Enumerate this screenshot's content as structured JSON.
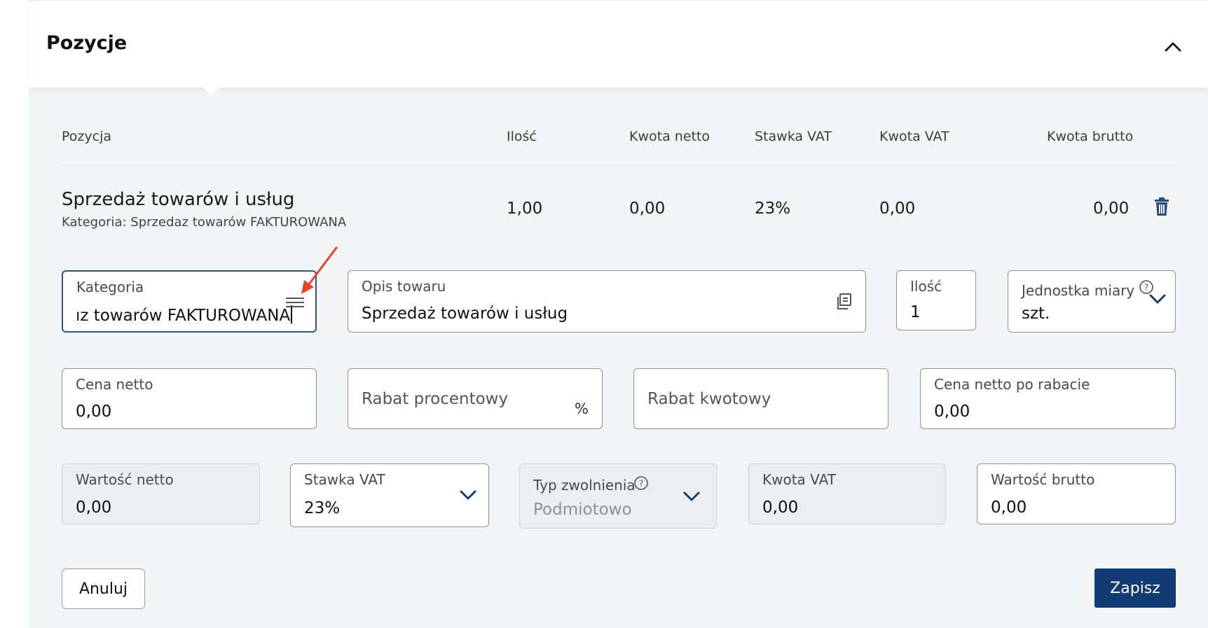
{
  "section": {
    "title": "Pozycje"
  },
  "table": {
    "headers": [
      "Pozycja",
      "Ilość",
      "Kwota netto",
      "Stawka VAT",
      "Kwota VAT",
      "Kwota brutto"
    ],
    "row": {
      "name": "Sprzedaż towarów i usług",
      "category": "Kategoria: Sprzedaz towarów FAKTUROWANA",
      "qty": "1,00",
      "net": "0,00",
      "vat_rate": "23%",
      "vat_amount": "0,00",
      "gross": "0,00"
    }
  },
  "form": {
    "kategoria": {
      "label": "Kategoria",
      "value": "ız towarów FAKTUROWANA"
    },
    "opis": {
      "label": "Opis towaru",
      "value": "Sprzedaż towarów i usług"
    },
    "ilosc": {
      "label": "Ilość",
      "value": "1"
    },
    "jednostka": {
      "label": "Jednostka miary",
      "value": "szt."
    },
    "cena_netto": {
      "label": "Cena netto",
      "value": "0,00"
    },
    "rabat_proc": {
      "placeholder": "Rabat procentowy",
      "suffix": "%"
    },
    "rabat_kwot": {
      "placeholder": "Rabat kwotowy"
    },
    "cena_po_rabacie": {
      "label": "Cena netto po rabacie",
      "value": "0,00"
    },
    "wartosc_netto": {
      "label": "Wartość netto",
      "value": "0,00"
    },
    "stawka_vat": {
      "label": "Stawka VAT",
      "value": "23%"
    },
    "typ_zwolnienia": {
      "label": "Typ zwolnienia",
      "value": "Podmiotowo"
    },
    "kwota_vat": {
      "label": "Kwota VAT",
      "value": "0,00"
    },
    "wartosc_brutto": {
      "label": "Wartość brutto",
      "value": "0,00"
    }
  },
  "buttons": {
    "cancel": "Anuluj",
    "save": "Zapisz"
  },
  "colors": {
    "primary": "#123a73",
    "focus": "#33537f",
    "annotation": "#e8412f"
  },
  "icons": [
    "chevron-up-icon",
    "trash-icon",
    "list-icon",
    "document-icon",
    "help-icon",
    "chevron-down-icon",
    "arrow-annotation-icon"
  ]
}
